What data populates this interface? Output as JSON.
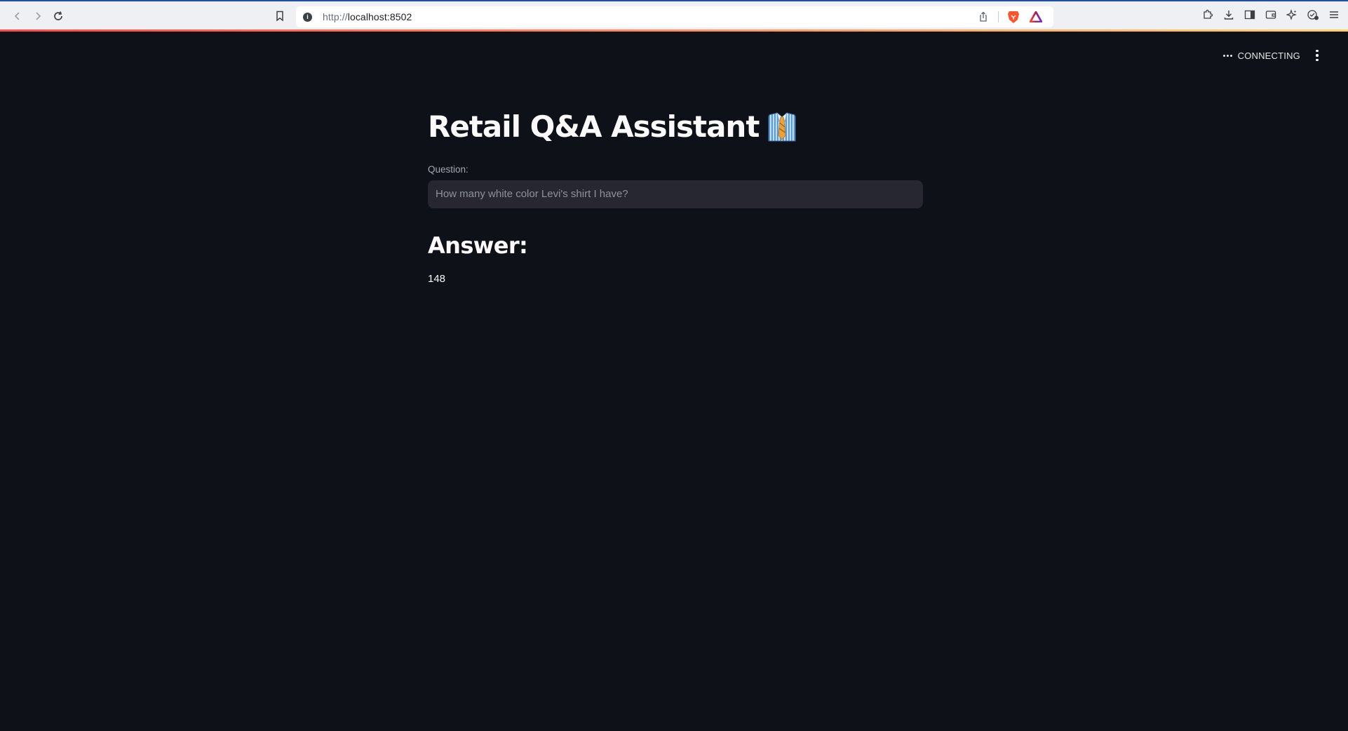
{
  "browser": {
    "url_protocol": "http://",
    "url_host": "localhost:8502"
  },
  "app": {
    "status_text": "CONNECTING",
    "title": "Retail Q&A Assistant",
    "question_label": "Question:",
    "question_placeholder": "How many white color Levi's shirt I have?",
    "answer_heading": "Answer:",
    "answer_value": "148"
  },
  "icons": {
    "back": "chevron-left-icon",
    "forward": "chevron-right-icon",
    "reload": "reload-icon",
    "bookmark": "bookmark-icon",
    "site_info": "info-icon",
    "share": "share-icon",
    "brave_shields": "brave-lion-icon",
    "brave_rewards": "triangle-rewards-icon",
    "extensions": "puzzle-icon",
    "downloads": "download-icon",
    "sidebar": "sidebar-icon",
    "wallet": "wallet-icon",
    "leo": "leo-star-icon",
    "vpn": "vpn-icon",
    "menu": "hamburger-menu-icon",
    "title_emoji": "shirt-with-tie-icon"
  },
  "colors": {
    "app_background": "#0e1117",
    "text_primary": "#fafafa",
    "input_background": "#262730",
    "accent": "#ff4b4b"
  }
}
